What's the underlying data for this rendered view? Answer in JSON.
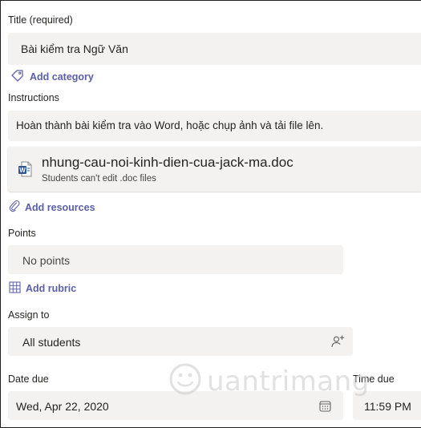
{
  "title_section": {
    "label": "Title (required)",
    "value": "Bài kiểm tra Ngữ Văn",
    "add_category_label": "Add category",
    "category_icon": "tag-icon"
  },
  "instructions_section": {
    "label": "Instructions",
    "value": "Hoàn thành bài kiểm tra vào Word, hoặc chụp ảnh và tải file lên."
  },
  "attachment": {
    "file_name": "nhung-cau-noi-kinh-dien-cua-jack-ma.doc",
    "note": "Students can't edit .doc files",
    "icon": "word-document-icon"
  },
  "resources": {
    "add_resources_label": "Add resources",
    "icon": "paperclip-icon"
  },
  "points_section": {
    "label": "Points",
    "value": "No points",
    "add_rubric_label": "Add rubric",
    "rubric_icon": "grid-icon"
  },
  "assign_section": {
    "label": "Assign to",
    "value": "All students",
    "icon": "add-person-icon"
  },
  "due_section": {
    "date_label": "Date due",
    "date_value": "Wed, Apr 22, 2020",
    "date_icon": "calendar-icon",
    "time_label": "Time due",
    "time_value": "11:59 PM"
  },
  "watermark": {
    "text": "uantrimang",
    "icon": "quantrimang-logo"
  },
  "colors": {
    "accent": "#6264a7",
    "field_bg": "#f3f2f1",
    "word_blue": "#2b579a"
  }
}
